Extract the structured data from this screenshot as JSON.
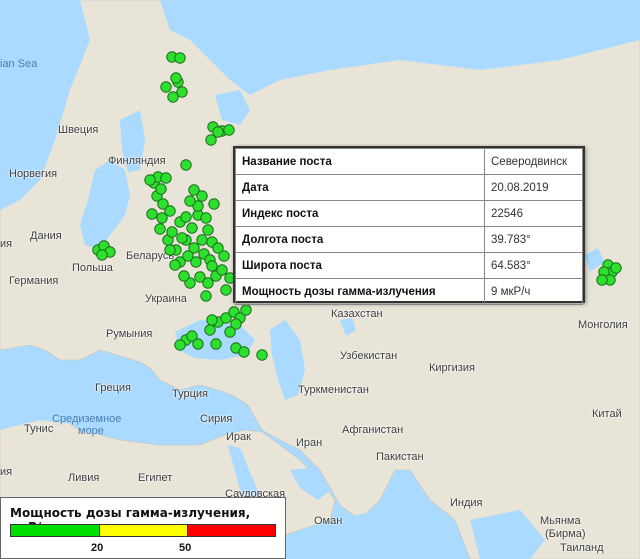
{
  "map": {
    "labels": [
      {
        "name": "label-sea-partial",
        "text": "ian Sea",
        "sea": true
      },
      {
        "name": "label-sweden",
        "text": "Швеция"
      },
      {
        "name": "label-finland",
        "text": "Финляндия"
      },
      {
        "name": "label-norway",
        "text": "Норвегия"
      },
      {
        "name": "label-denmark",
        "text": "Дания"
      },
      {
        "name": "label-belarus",
        "text": "Беларусь"
      },
      {
        "name": "label-poland",
        "text": "Польша"
      },
      {
        "name": "label-germany",
        "text": "Германия"
      },
      {
        "name": "label-ukraine",
        "text": "Украина"
      },
      {
        "name": "label-kazakhstan",
        "text": "Казахстан"
      },
      {
        "name": "label-mongolia",
        "text": "Монголия"
      },
      {
        "name": "label-romania",
        "text": "Румыния"
      },
      {
        "name": "label-uzbekistan",
        "text": "Узбекистан"
      },
      {
        "name": "label-kyrgyzstan",
        "text": "Киргизия"
      },
      {
        "name": "label-turkmenistan",
        "text": "Туркменистан"
      },
      {
        "name": "label-greece",
        "text": "Греция"
      },
      {
        "name": "label-turkey",
        "text": "Турция"
      },
      {
        "name": "label-tunisia",
        "text": "Тунис"
      },
      {
        "name": "label-syria",
        "text": "Сирия"
      },
      {
        "name": "label-mediterranean",
        "text": "Средиземное",
        "sea": true
      },
      {
        "name": "label-mediterranean-2",
        "text": "море",
        "sea": true
      },
      {
        "name": "label-iraq",
        "text": "Ирак"
      },
      {
        "name": "label-afghanistan",
        "text": "Афганистан"
      },
      {
        "name": "label-iran",
        "text": "Иран"
      },
      {
        "name": "label-china",
        "text": "Китай"
      },
      {
        "name": "label-pakistan",
        "text": "Пакистан"
      },
      {
        "name": "label-india",
        "text": "Индия"
      },
      {
        "name": "label-libya",
        "text": "Ливия"
      },
      {
        "name": "label-egypt",
        "text": "Египет"
      },
      {
        "name": "label-saudi-arabia",
        "text": "Саудовская"
      },
      {
        "name": "label-oman",
        "text": "Оман"
      },
      {
        "name": "label-myanmar",
        "text": "Мьянма"
      },
      {
        "name": "label-myanmar-2",
        "text": "(Бирма)"
      },
      {
        "name": "label-thailand",
        "text": "Таиланд"
      },
      {
        "name": "label-left-partial",
        "text": "ия"
      },
      {
        "name": "label-left-partial-2",
        "text": "ия"
      }
    ]
  },
  "info": {
    "rows": [
      {
        "key": "Название поста",
        "value": "Северодвинск"
      },
      {
        "key": "Дата",
        "value": "20.08.2019"
      },
      {
        "key": "Индекс поста",
        "value": "22546"
      },
      {
        "key": "Долгота поста",
        "value": "39.783°"
      },
      {
        "key": "Широта поста",
        "value": "64.583°"
      },
      {
        "key": "Мощность дозы гамма-излучения",
        "value": "9 мкР/ч"
      }
    ]
  },
  "legend": {
    "title": "Мощность дозы гамма-излучения, мкР/ч",
    "tick_20": "20",
    "tick_50": "50",
    "colors": {
      "low": "#00e000",
      "mid": "#ffff00",
      "high": "#ff0000"
    }
  },
  "marker_color": "#2ee02e"
}
